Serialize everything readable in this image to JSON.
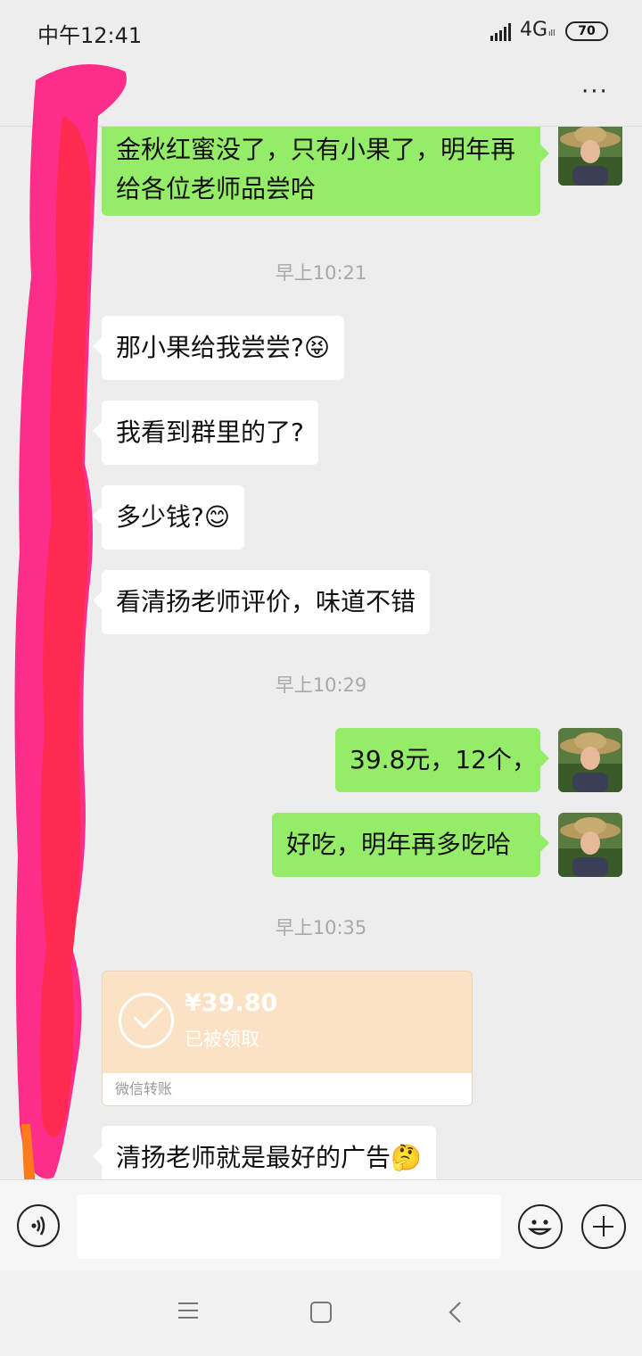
{
  "status_bar": {
    "time": "中午12:41",
    "network": "4G",
    "network_sub": "ıll",
    "battery": "70"
  },
  "header": {
    "more_label": "···"
  },
  "messages": [
    {
      "side": "out",
      "text": "金秋红蜜没了，只有小果了，明年再给各位老师品尝哈"
    },
    {
      "type": "time",
      "text": "早上10:21"
    },
    {
      "side": "in",
      "text": "那小果给我尝尝?",
      "emoji": "😝"
    },
    {
      "side": "in",
      "text": "我看到群里的了?"
    },
    {
      "side": "in",
      "text": "多少钱?",
      "emoji": "😊"
    },
    {
      "side": "in",
      "text": "看清扬老师评价，味道不错"
    },
    {
      "type": "time",
      "text": "早上10:29"
    },
    {
      "side": "out",
      "text": "39.8元，12个，"
    },
    {
      "side": "out",
      "text": "好吃，明年再多吃哈"
    },
    {
      "type": "time",
      "text": "早上10:35"
    },
    {
      "side": "in",
      "type": "transfer",
      "amount": "¥39.80",
      "status": "已被领取",
      "footer": "微信转账"
    },
    {
      "side": "in",
      "text": "清扬老师就是最好的广告",
      "emoji": "🤔"
    }
  ],
  "input_bar": {
    "placeholder": ""
  },
  "colors": {
    "background": "#ededed",
    "bubble_out": "#95ec69",
    "bubble_in": "#ffffff",
    "transfer_card": "#fce2c5",
    "scribble_pink": "#ff2d8a",
    "scribble_red": "#ff2a4f",
    "scribble_orange": "#ff7a1a"
  }
}
